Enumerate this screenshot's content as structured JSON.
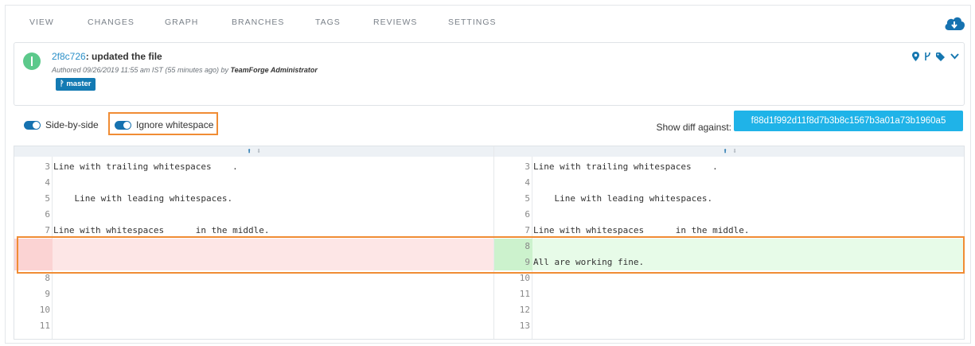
{
  "nav": {
    "tabs": [
      "VIEW",
      "CHANGES",
      "GRAPH",
      "BRANCHES",
      "TAGS",
      "REVIEWS",
      "SETTINGS"
    ],
    "download_icon": "cloud-download-icon"
  },
  "commit": {
    "hash": "2f8c726",
    "message": ": updated the file",
    "authored_prefix": "Authored   09/26/2019 11:55 am IST (55 minutes ago) by ",
    "author": "TeamForge Administrator",
    "branch": "master",
    "icons": [
      "map-marker-icon",
      "branch-icon",
      "tag-icon",
      "chevron-down-icon"
    ]
  },
  "options": {
    "side_by_side": "Side-by-side",
    "ignore_whitespace": "Ignore whitespace",
    "show_diff_label": "Show diff against:",
    "diff_target": "f88d1f992d11f8d7b3b8c1567b3a01a73b1960a5"
  },
  "colors": {
    "accent": "#1672b0",
    "button": "#1fb3e8",
    "highlight": "#f08c34",
    "removed_bg": "#fde6e6",
    "added_bg": "#e7fbe8"
  },
  "diff": {
    "left": [
      {
        "num": "3",
        "code": "Line with trailing whitespaces    ."
      },
      {
        "num": "4",
        "code": ""
      },
      {
        "num": "5",
        "code": "    Line with leading whitespaces."
      },
      {
        "num": "6",
        "code": ""
      },
      {
        "num": "7",
        "code": "Line with whitespaces      in the middle."
      },
      {
        "num": "",
        "code": ""
      },
      {
        "num": "",
        "code": ""
      },
      {
        "num": "8",
        "code": ""
      },
      {
        "num": "9",
        "code": ""
      },
      {
        "num": "10",
        "code": ""
      },
      {
        "num": "11",
        "code": ""
      }
    ],
    "right": [
      {
        "num": "3",
        "code": "Line with trailing whitespaces    ."
      },
      {
        "num": "4",
        "code": ""
      },
      {
        "num": "5",
        "code": "    Line with leading whitespaces."
      },
      {
        "num": "6",
        "code": ""
      },
      {
        "num": "7",
        "code": "Line with whitespaces      in the middle."
      },
      {
        "num": "8",
        "code": ""
      },
      {
        "num": "9",
        "code": "All are working fine."
      },
      {
        "num": "10",
        "code": ""
      },
      {
        "num": "11",
        "code": ""
      },
      {
        "num": "12",
        "code": ""
      },
      {
        "num": "13",
        "code": ""
      }
    ]
  }
}
